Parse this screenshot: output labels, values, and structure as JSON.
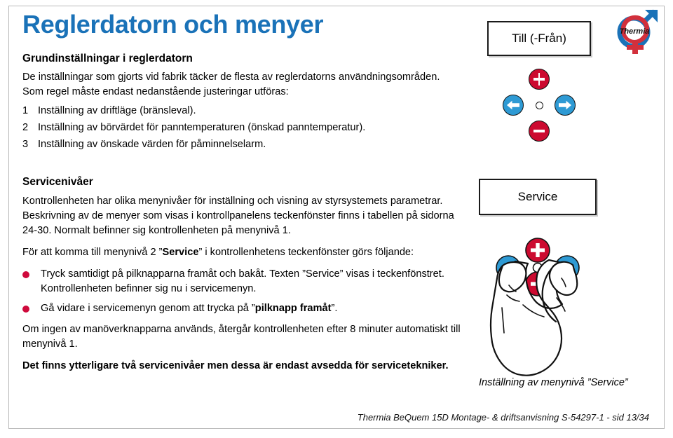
{
  "document": {
    "title": "Reglerdatorn och menyer",
    "title_color": "#1a72b8",
    "bullet_color": "#cf0a3c"
  },
  "section1": {
    "heading": "Grundinställningar i reglerdatorn",
    "intro": "De inställningar som gjorts vid fabrik täcker de flesta av reglerdatorns användningsområden. Som regel måste endast nedanstående justeringar utföras:",
    "items": [
      {
        "num": "1",
        "text": "Inställning av driftläge (bränsleval)."
      },
      {
        "num": "2",
        "text": "Inställning av börvärdet för panntemperaturen (önskad panntemperatur)."
      },
      {
        "num": "3",
        "text": "Inställning av önskade värden för påminnelselarm."
      }
    ]
  },
  "section2": {
    "heading": "Servicenivåer",
    "para1": "Kontrollenheten har olika menynivåer för inställning och visning av styrsystemets parametrar. Beskrivning av de menyer som visas i kontrollpanelens teckenfönster finns i tabellen på sidorna 24-30. Normalt befinner sig kontrollenheten på menynivå 1.",
    "para2_pre": "För att komma till menynivå 2 ”",
    "para2_bold": "Service",
    "para2_post": "” i kontrollenhetens teckenfönster görs följande:",
    "bullets": [
      {
        "pre": "Tryck samtidigt på pilknapparna framåt och bakåt. Texten ”Service” visas i teckenfönstret. Kontrollenheten befinner sig nu i servicemenyn.",
        "bold": "",
        "post": ""
      },
      {
        "pre": "Gå vidare i servicemenyn genom att trycka på ”",
        "bold": "pilknapp framåt",
        "post": "”."
      }
    ],
    "para3": "Om ingen av manöverknapparna används, återgår kontrollenheten efter 8 minuter automatiskt till menynivå 1.",
    "para4": "Det finns ytterligare två servicenivåer men dessa är endast avsedda för servicetekniker."
  },
  "illustration_top": {
    "display_text": "Till (-Från)",
    "keys": {
      "plus": "plus-key",
      "minus": "minus-key",
      "left": "arrow-back-key",
      "right": "arrow-forward-key",
      "center": "indicator-lamp"
    }
  },
  "illustration_bottom": {
    "display_text": "Service",
    "caption": "Inställning av menynivå ”Service”"
  },
  "logo": {
    "wordmark": "Thermia",
    "blue": "#1a72b8",
    "red": "#d2303c"
  },
  "footer": {
    "text": "Thermia BeQuem 15D Montage- & driftsanvisning S-54297-1 - sid 13/34"
  }
}
